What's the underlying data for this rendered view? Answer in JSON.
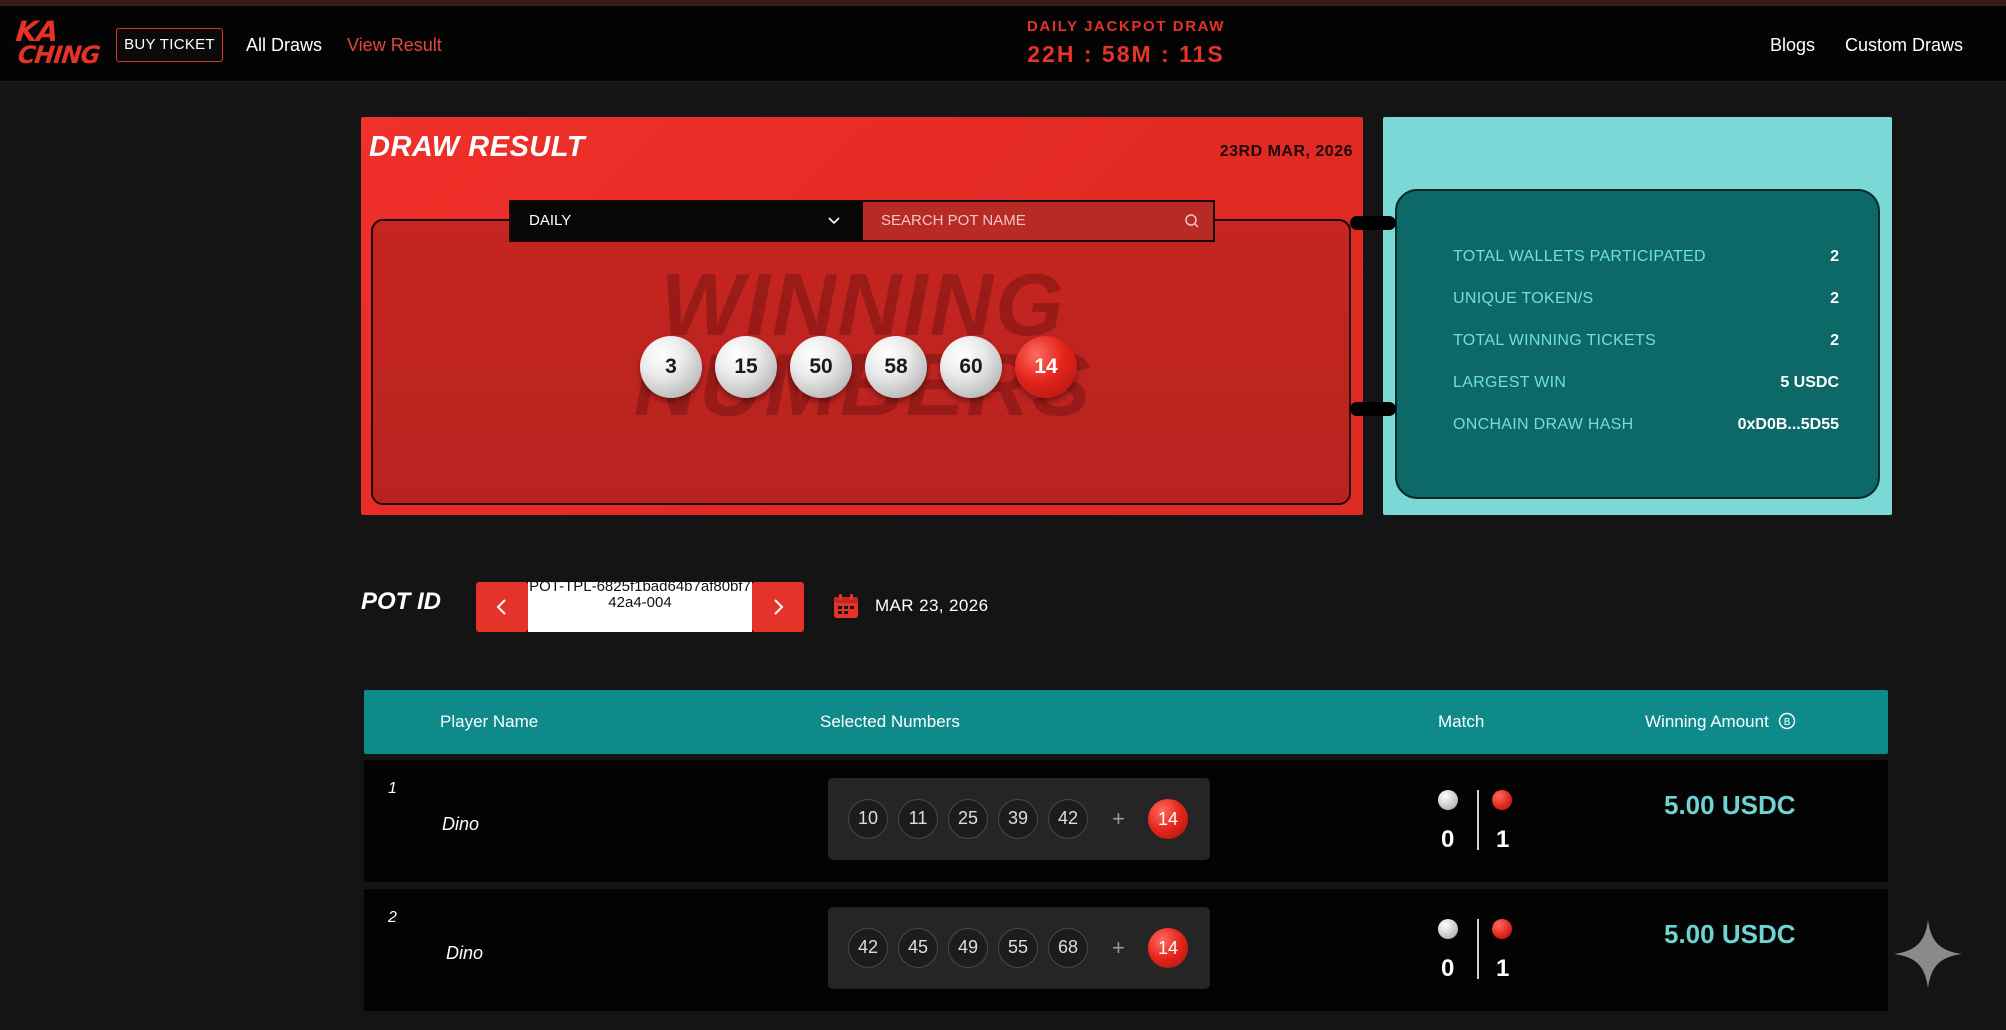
{
  "header": {
    "logo_line1": "KA",
    "logo_line2": "CHING",
    "buy_ticket": "BUY TICKET",
    "nav_left": [
      "All Draws",
      "View Result"
    ],
    "jackpot_title": "DAILY JACKPOT DRAW",
    "countdown": "22H : 58M : 11S",
    "nav_right": [
      "Blogs",
      "Custom Draws"
    ]
  },
  "draw": {
    "title": "DRAW RESULT",
    "date": "23RD MAR, 2026",
    "filter_value": "DAILY",
    "search_placeholder": "SEARCH POT NAME",
    "watermark_line1": "WINNING",
    "watermark_line2": "NUMBERS",
    "winning_numbers": [
      "3",
      "15",
      "50",
      "58",
      "60"
    ],
    "bonus_number": "14"
  },
  "stats": {
    "rows": [
      {
        "label": "TOTAL WALLETS PARTICIPATED",
        "value": "2"
      },
      {
        "label": "UNIQUE TOKEN/S",
        "value": "2"
      },
      {
        "label": "TOTAL WINNING TICKETS",
        "value": "2"
      },
      {
        "label": "LARGEST WIN",
        "value": "5 USDC"
      },
      {
        "label": "ONCHAIN DRAW HASH",
        "value": "0xD0B...5D55"
      }
    ]
  },
  "pot": {
    "label": "POT ID",
    "id": "POT-TPL-6825f1bad64b7af80bf742a4-004",
    "date": "MAR 23, 2026"
  },
  "table": {
    "headers": {
      "player": "Player Name",
      "numbers": "Selected Numbers",
      "match": "Match",
      "winning": "Winning Amount"
    },
    "rows": [
      {
        "index": "1",
        "player": "Dino",
        "numbers": [
          "10",
          "11",
          "25",
          "39",
          "42"
        ],
        "plus": "+",
        "bonus": "14",
        "match_white": "0",
        "match_red": "1",
        "amount": "5.00 USDC"
      },
      {
        "index": "2",
        "player": "Dino",
        "numbers": [
          "42",
          "45",
          "49",
          "55",
          "68"
        ],
        "plus": "+",
        "bonus": "14",
        "match_white": "0",
        "match_red": "1",
        "amount": "5.00 USDC"
      }
    ]
  },
  "colors": {
    "brand_red": "#e5332a",
    "teal_light": "#7ad9d7",
    "teal_dark": "#0c6968",
    "table_head": "#0e8a8a",
    "win_amount": "#6fd3d1"
  }
}
